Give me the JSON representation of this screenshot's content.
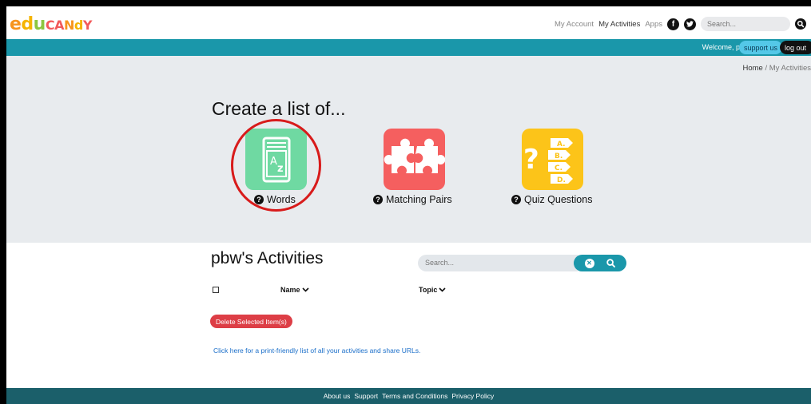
{
  "header": {
    "logo_letters": [
      {
        "ch": "e",
        "color": "#f7941d"
      },
      {
        "ch": "d",
        "color": "#f5b400"
      },
      {
        "ch": "u",
        "color": "#8cc63f"
      },
      {
        "ch": "C",
        "color": "#f25a5a"
      },
      {
        "ch": "A",
        "color": "#f25a5a"
      },
      {
        "ch": "N",
        "color": "#f7941d"
      },
      {
        "ch": "d",
        "color": "#f5b400"
      },
      {
        "ch": "Y",
        "color": "#f25a5a"
      }
    ],
    "nav": {
      "my_account": "My Account",
      "my_activities": "My Activities",
      "apps": "Apps"
    },
    "social": {
      "facebook": "f",
      "twitter": "t"
    },
    "search_placeholder": "Search..."
  },
  "userbar": {
    "welcome": "Welcome, pbw!",
    "support": "support us",
    "logout": "log out"
  },
  "breadcrumb": {
    "home": "Home",
    "separator": "/",
    "current": "My Activities"
  },
  "create": {
    "title": "Create a list of...",
    "options": [
      {
        "label": "Words",
        "icon": "book-az-icon",
        "color": "#6fd9a2"
      },
      {
        "label": "Matching Pairs",
        "icon": "puzzle-icon",
        "color": "#f55f5f"
      },
      {
        "label": "Quiz Questions",
        "icon": "quiz-abcd-icon",
        "color": "#fcc419"
      }
    ],
    "word_tile_glyph": "A",
    "word_tile_glyph2": "z",
    "quiz_letters": [
      "A.",
      "B.",
      "C.",
      "D."
    ],
    "help_glyph": "?"
  },
  "activities": {
    "title": "pbw's Activities",
    "search_placeholder": "Search...",
    "columns": {
      "name": "Name",
      "topic": "Topic"
    },
    "delete_label": "Delete Selected Item(s)",
    "print_link": "Click here for a print-friendly list of all your activities and share URLs."
  },
  "footer": {
    "links": [
      "About us",
      "Support",
      "Terms and Conditions",
      "Privacy Policy"
    ]
  },
  "colors": {
    "teal": "#1a97aa",
    "footer": "#1b5f6a",
    "delete": "#dd3e46",
    "link": "#1a6ec9",
    "annotation": "#d81b1b"
  }
}
